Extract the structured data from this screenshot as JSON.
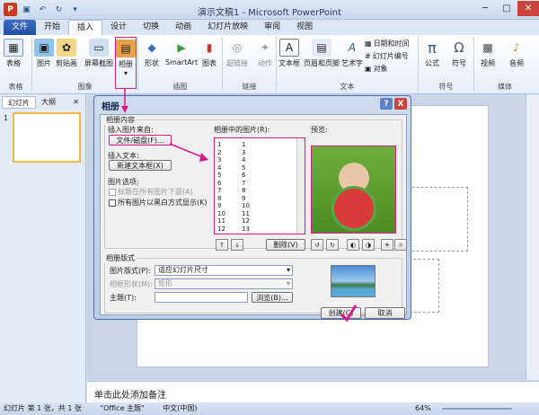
{
  "window": {
    "title": "演示文稿1 - Microsoft PowerPoint"
  },
  "tabs": [
    "文件",
    "开始",
    "插入",
    "设计",
    "切换",
    "动画",
    "幻灯片放映",
    "审阅",
    "视图"
  ],
  "ribbon": {
    "groups": {
      "table": "表格",
      "image": "图像",
      "illustration": "插图",
      "link": "链接",
      "text": "文本",
      "symbol": "符号",
      "media": "媒体"
    },
    "buttons": {
      "table": "表格",
      "picture": "图片",
      "clipart": "剪贴画",
      "screenshot": "屏幕截图",
      "album": "相册",
      "shapes": "形状",
      "smartart": "SmartArt",
      "chart": "图表",
      "hyperlink": "超链接",
      "action": "动作",
      "textbox": "文本框",
      "headerfooter": "页眉和页脚",
      "wordart": "艺术字",
      "equation": "公式",
      "symbol": "符号",
      "video": "视频",
      "audio": "音频"
    },
    "small": {
      "datetime": "日期和时间",
      "slidenum": "幻灯片编号",
      "object": "对象"
    }
  },
  "left_panel": {
    "tabs": [
      "幻灯片",
      "大纲"
    ],
    "thumb_number": "1"
  },
  "notes": "单击此处添加备注",
  "status": {
    "slide_info": "幻灯片 第 1 张，共 1 张",
    "theme": "\"Office 主题\"",
    "language": "中文(中国)",
    "zoom": "64%"
  },
  "dialog": {
    "title": "相册",
    "content_group": "相册内容",
    "insert_picture_from": "插入图片来自:",
    "file_disk_button": "文件/磁盘(F)...",
    "insert_text": "插入文本:",
    "new_textbox_button": "新建文本框(X)",
    "picture_options": "图片选项:",
    "captions_below": "标题在所有图片下面(A)",
    "all_black_white": "所有图片以黑白方式显示(K)",
    "pictures_in_album": "相册中的图片(R):",
    "preview": "预览:",
    "list_left": [
      "1",
      "2",
      "3",
      "4",
      "5",
      "6",
      "7",
      "8",
      "9",
      "10",
      "11",
      "12"
    ],
    "list_right": [
      "1",
      "3",
      "4",
      "5",
      "6",
      "7",
      "8",
      "9",
      "10",
      "11",
      "12",
      "13"
    ],
    "remove_button": "删除(V)",
    "layout_group": "相册版式",
    "picture_layout_label": "图片版式(P):",
    "picture_layout_value": "适应幻灯片尺寸",
    "frame_shape_label": "相框形状(M):",
    "frame_shape_value": "矩形",
    "theme_label": "主题(T):",
    "browse_button": "浏览(B)...",
    "create_button": "创建(C)",
    "cancel_button": "取消",
    "help": "?",
    "close": "X"
  }
}
